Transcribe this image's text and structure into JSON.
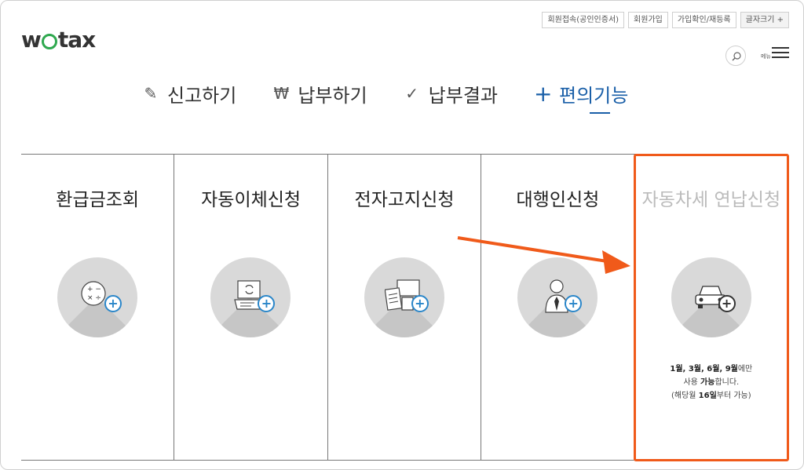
{
  "logo": {
    "prefix": "w",
    "suffix": "tax"
  },
  "util_links": [
    "회원접속(공인인증서)",
    "회원가입",
    "가입확인/재등록",
    "글자크기 +"
  ],
  "header": {
    "menu_label": "메뉴"
  },
  "nav": [
    {
      "label": "신고하기",
      "icon": "pencil-icon"
    },
    {
      "label": "납부하기",
      "icon": "won-icon"
    },
    {
      "label": "납부결과",
      "icon": "check-icon"
    },
    {
      "label": "편의기능",
      "icon": "plus-icon",
      "active": true
    }
  ],
  "services": [
    {
      "title": "환급금조회",
      "icon": "calculator-icon"
    },
    {
      "title": "자동이체신청",
      "icon": "laptop-sync-icon"
    },
    {
      "title": "전자고지신청",
      "icon": "documents-icon"
    },
    {
      "title": "대행인신청",
      "icon": "person-icon"
    },
    {
      "title": "자동차세 연납신청",
      "icon": "car-icon",
      "disabled": true,
      "note": {
        "line1_bold": "1월, 3월, 6월, 9월",
        "line1_rest": "에만",
        "line2_pre": "사용 ",
        "line2_bold": "가능",
        "line2_rest": "합니다.",
        "line3_pre": "(해당월 ",
        "line3_bold": "16일",
        "line3_rest": "부터 가능)"
      }
    }
  ],
  "colors": {
    "accent": "#1a5fa8",
    "highlight": "#f05a1a",
    "plus": "#2a86c9"
  }
}
